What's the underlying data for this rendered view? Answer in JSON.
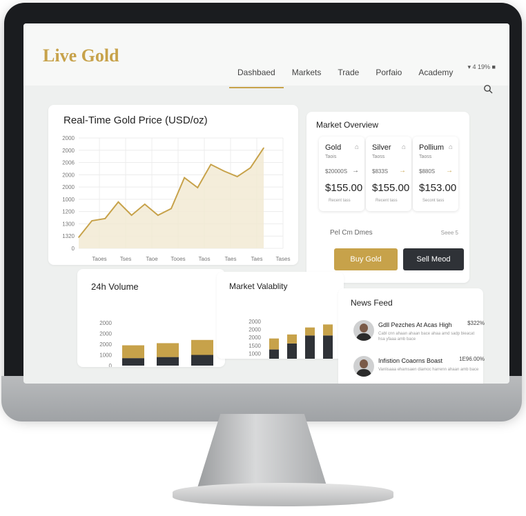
{
  "app": {
    "logo": "Live Gold"
  },
  "nav": {
    "items": [
      "Dashbaed",
      "Markets",
      "Trade",
      "Porfaio",
      "Academy"
    ],
    "active_index": 0
  },
  "status_bar": {
    "text": "▾ 4 19% ■"
  },
  "price_chart": {
    "title": "Real-Time Gold Price (USD/oz)",
    "y_ticks": [
      "2000",
      "2000",
      "2006",
      "2000",
      "2000",
      "1000",
      "1200",
      "1300",
      "1320",
      "0"
    ],
    "x_ticks": [
      "Taoes",
      "Tses",
      "Taoe",
      "Tooes",
      "Taos",
      "Taes",
      "Taes",
      "Tases"
    ]
  },
  "market_overview": {
    "title": "Market Overview",
    "cards": [
      {
        "name": "Gold",
        "sub": "Taois",
        "code": "$20000S",
        "price": "$155.00",
        "foot": "Recent tass",
        "arrow_color": "#555555"
      },
      {
        "name": "Silver",
        "sub": "Taoss",
        "code": "$833S",
        "price": "$155.00",
        "foot": "Recent tass",
        "arrow_color": "#c7a24a"
      },
      {
        "name": "Pollium",
        "sub": "Taoss",
        "code": "$880S",
        "price": "$153.00",
        "foot": "Secont tass",
        "arrow_color": "#c7a24a"
      }
    ],
    "subhead": "Pel Cm Dmes",
    "subhead_right": "Seee 5",
    "buy_label": "Buy Gold",
    "sell_label": "Sell Meod",
    "accent": "#c7a24a",
    "dark": "#2f3237"
  },
  "volume_chart": {
    "title": "24h Volume",
    "y_ticks": [
      "2000",
      "2000",
      "2000",
      "1000",
      "0"
    ],
    "x_ticks": [
      "Taoes",
      "Taoes",
      "Taoes"
    ]
  },
  "volatility_chart": {
    "title": "Market Valablity",
    "y_ticks": [
      "2000",
      "2000",
      "2000",
      "1500",
      "1000",
      "0"
    ],
    "x_ticks": [
      "Taoes",
      "Taoes",
      "Taoes",
      "Taoes"
    ]
  },
  "news": {
    "title": "News Feed",
    "items": [
      {
        "headline": "Gdll Pezches At Acas High",
        "value": "$322%",
        "body": "Cabl cnn ahaan ahaan bace ahaa amd sadp bieacat hsa yfaaa amb bace"
      },
      {
        "headline": "Infistion Coaorns Boast",
        "value": "1E96.00%",
        "body": "Vanlisaaa ehamsaen diamoc harrenn ahaan amb bace"
      }
    ]
  },
  "chart_data": [
    {
      "type": "line",
      "title": "Real-Time Gold Price (USD/oz)",
      "xlabel": "",
      "ylabel": "",
      "series": [
        {
          "values": [
            0.1,
            0.25,
            0.27,
            0.42,
            0.3,
            0.4,
            0.3,
            0.36,
            0.64,
            0.55,
            0.76,
            0.7,
            0.65,
            0.73,
            0.91
          ]
        }
      ],
      "ylim": [
        0,
        1
      ],
      "grid": true,
      "area_fill": true,
      "color": "#c7a24a"
    },
    {
      "type": "bar",
      "title": "24h Volume",
      "categories": [
        "Taoes",
        "Taoes",
        "Taoes"
      ],
      "series": [
        {
          "values": [
            350,
            400,
            500
          ],
          "color": "#2f3237"
        },
        {
          "values": [
            600,
            650,
            700
          ],
          "color": "#c7a24a"
        }
      ],
      "stacked": true,
      "ylim": [
        0,
        2000
      ]
    },
    {
      "type": "bar",
      "title": "Market Valablity",
      "categories": [
        "Taoes",
        "Taoes",
        "Taoes",
        "Taoes"
      ],
      "series": [
        {
          "values": [
            600,
            900,
            1300,
            1300
          ],
          "color": "#2f3237"
        },
        {
          "values": [
            550,
            450,
            400,
            550
          ],
          "color": "#c7a24a"
        }
      ],
      "stacked": true,
      "ylim": [
        0,
        2000
      ]
    }
  ]
}
